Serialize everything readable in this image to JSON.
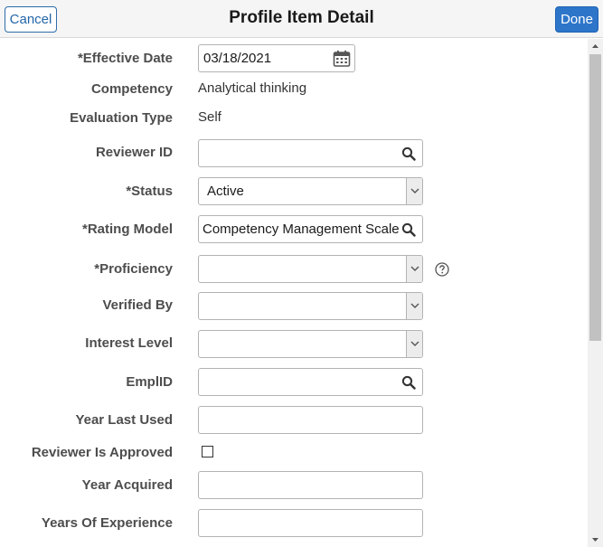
{
  "header": {
    "title": "Profile Item Detail",
    "cancel_label": "Cancel",
    "done_label": "Done"
  },
  "form": {
    "effective_date": {
      "label": "*Effective Date",
      "value": "03/18/2021"
    },
    "competency": {
      "label": "Competency",
      "value": "Analytical thinking"
    },
    "evaluation_type": {
      "label": "Evaluation Type",
      "value": "Self"
    },
    "reviewer_id": {
      "label": "Reviewer ID",
      "value": ""
    },
    "status": {
      "label": "*Status",
      "value": "Active"
    },
    "rating_model": {
      "label": "*Rating Model",
      "value": "Competency Management Scale"
    },
    "proficiency": {
      "label": "*Proficiency",
      "value": ""
    },
    "verified_by": {
      "label": "Verified By",
      "value": ""
    },
    "interest_level": {
      "label": "Interest Level",
      "value": ""
    },
    "emplid": {
      "label": "EmplID",
      "value": ""
    },
    "year_last_used": {
      "label": "Year Last Used",
      "value": ""
    },
    "reviewer_is_approved": {
      "label": "Reviewer Is Approved",
      "checked": false
    },
    "year_acquired": {
      "label": "Year Acquired",
      "value": ""
    },
    "years_of_experience": {
      "label": "Years Of Experience",
      "value": ""
    }
  },
  "icons": {
    "lookup": "search-icon",
    "calendar": "calendar-icon",
    "help": "help-icon",
    "dropdown": "chevron-down-icon"
  },
  "colors": {
    "done_button": "#2d75c9",
    "cancel_border": "#2e6ca8",
    "header_bg": "#f5f5f5"
  }
}
